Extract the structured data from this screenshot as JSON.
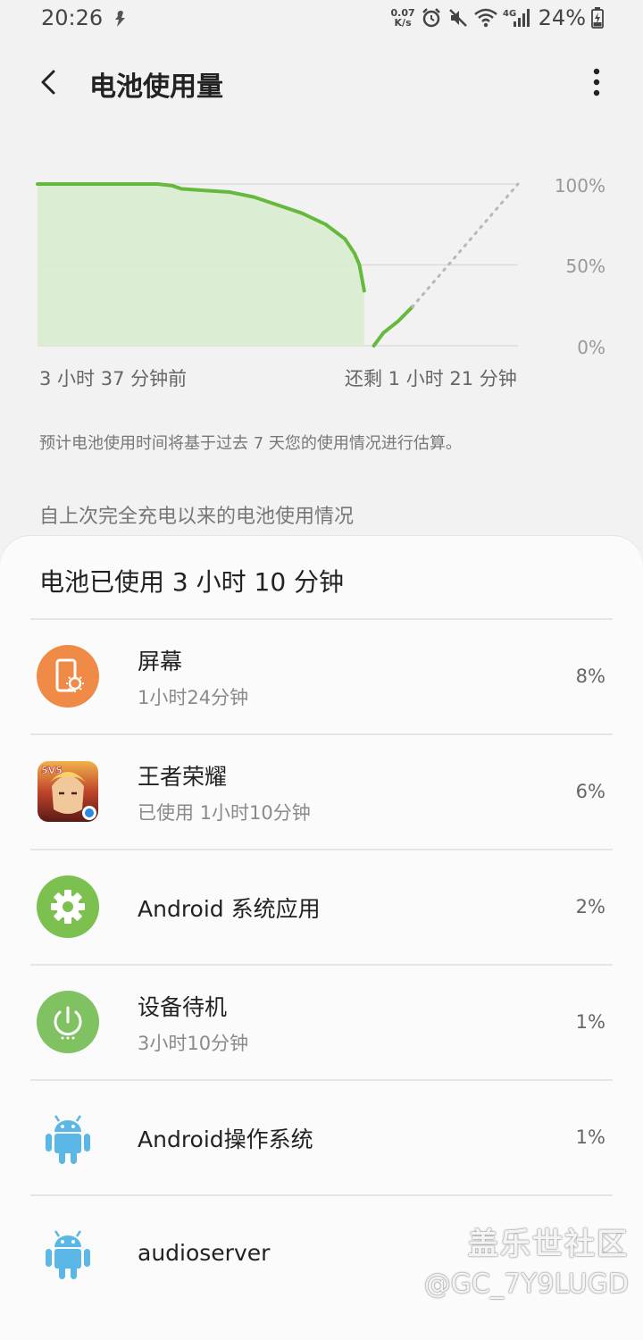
{
  "status_bar": {
    "time": "20:26",
    "net_speed_top": "0.07",
    "net_speed_bottom": "K/s",
    "network_type": "4G",
    "battery": "24%",
    "icons": [
      "notification-icon",
      "alarm-icon",
      "mute-icon",
      "wifi-icon",
      "signal-icon",
      "battery-icon"
    ]
  },
  "app_bar": {
    "title": "电池使用量",
    "back_icon": "back-arrow-icon",
    "more_icon": "more-vert-icon"
  },
  "chart_data": {
    "type": "line",
    "y_ticks": [
      "100%",
      "50%",
      "0%"
    ],
    "ylim": [
      0,
      100
    ],
    "x_start_label": "3 小时 37 分钟前",
    "x_end_label": "还剩 1 小时 21 分钟",
    "series": [
      {
        "name": "history",
        "x": [
          0,
          0.05,
          0.1,
          0.15,
          0.2,
          0.25,
          0.28,
          0.3,
          0.35,
          0.4,
          0.45,
          0.5,
          0.55,
          0.6,
          0.64,
          0.66,
          0.67,
          0.68
        ],
        "values": [
          100,
          100,
          100,
          100,
          100,
          100,
          99,
          97,
          96,
          95,
          92,
          87,
          82,
          75,
          66,
          57,
          50,
          34
        ]
      },
      {
        "name": "current",
        "x": [
          0.7,
          0.72,
          0.75,
          0.78
        ],
        "values": [
          0,
          8,
          15,
          24
        ]
      },
      {
        "name": "prediction",
        "x": [
          0.78,
          1.0
        ],
        "values": [
          24,
          100
        ]
      }
    ],
    "line_color": "#67b93e",
    "fill_color": "#d7edcf",
    "prediction_color": "#b8b8b8"
  },
  "note": "预计电池使用时间将基于过去 7 天您的使用情况进行估算。",
  "section_title": "自上次完全充电以来的电池使用情况",
  "summary": "电池已使用 3 小时 10 分钟",
  "items": [
    {
      "name": "屏幕",
      "sub": "1小时24分钟",
      "pct": "8%",
      "icon": "screen-brightness-icon"
    },
    {
      "name": "王者荣耀",
      "sub": "已使用 1小时10分钟",
      "pct": "6%",
      "icon": "game-app-icon",
      "badge": "5V5"
    },
    {
      "name": "Android 系统应用",
      "sub": "",
      "pct": "2%",
      "icon": "gear-icon"
    },
    {
      "name": "设备待机",
      "sub": "3小时10分钟",
      "pct": "1%",
      "icon": "power-icon"
    },
    {
      "name": "Android操作系统",
      "sub": "",
      "pct": "1%",
      "icon": "android-icon"
    },
    {
      "name": "audioserver",
      "sub": "",
      "pct": "",
      "icon": "android-icon"
    }
  ],
  "watermark": {
    "line1": "盖乐世社区",
    "line2": "@GC_7Y9LUGD"
  },
  "colors": {
    "screen": "#ef8a47",
    "gear": "#7cc04f",
    "power": "#80c162",
    "android": "#5bb7e6"
  }
}
